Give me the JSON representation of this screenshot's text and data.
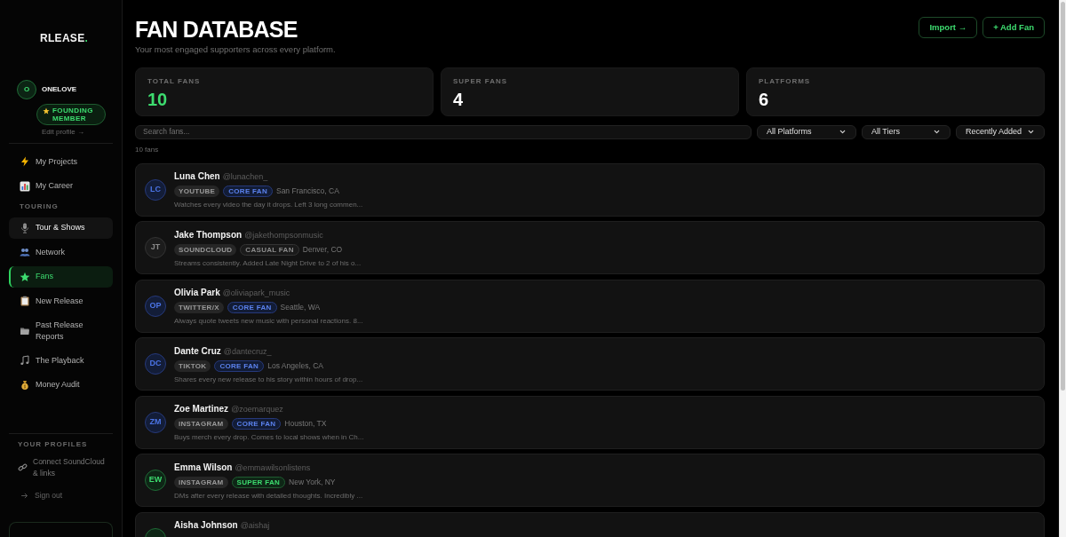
{
  "sidebar": {
    "logo": {
      "text": "RLEASE",
      "dot": "."
    },
    "profile": {
      "initial": "O",
      "name": "ONELOVE",
      "badge": "FOUNDING MEMBER",
      "edit_link": "Edit profile →"
    },
    "nav": [
      {
        "label": "My Projects",
        "selected": false,
        "hovered": false
      },
      {
        "label": "My Career",
        "selected": false,
        "hovered": false
      }
    ],
    "touring": {
      "heading": "TOURING",
      "items": [
        {
          "label": "Tour & Shows",
          "selected": false,
          "hovered": true
        },
        {
          "label": "Network",
          "selected": false,
          "hovered": false
        },
        {
          "label": "Fans",
          "selected": true,
          "hovered": false
        },
        {
          "label": "New Release",
          "selected": false,
          "hovered": false
        },
        {
          "label": "Past Release Reports",
          "selected": false,
          "hovered": false
        },
        {
          "label": "The Playback",
          "selected": false,
          "hovered": false
        },
        {
          "label": "Money Audit",
          "selected": false,
          "hovered": false
        }
      ]
    },
    "profiles": {
      "heading": "YOUR PROFILES",
      "connect_link": "Connect SoundCloud & links",
      "sign_out": "Sign out"
    }
  },
  "header": {
    "title": "FAN DATABASE",
    "subtitle": "Your most engaged supporters across every platform.",
    "buttons": [
      {
        "label": "Import →"
      },
      {
        "label": "+ Add Fan"
      }
    ]
  },
  "stats": [
    {
      "label": "TOTAL FANS",
      "value": "10",
      "accent": true
    },
    {
      "label": "SUPER FANS",
      "value": "4",
      "accent": false
    },
    {
      "label": "PLATFORMS",
      "value": "6",
      "accent": false
    }
  ],
  "filters": {
    "search": {
      "placeholder": "Search fans..."
    },
    "selects": [
      {
        "value": "All Platforms"
      },
      {
        "value": "All Tiers"
      },
      {
        "value": "Recently Added"
      }
    ]
  },
  "count": "10 fans",
  "fans": [
    {
      "kind": "core",
      "initials": "LC",
      "name": "Luna Chen",
      "handle": "@lunachen_",
      "platform": "YOUTUBE",
      "tier": "CORE FAN",
      "location": "San Francisco, CA",
      "note": "Watches every video the day it drops. Left 3 long commen..."
    },
    {
      "kind": "casual",
      "initials": "JT",
      "name": "Jake Thompson",
      "handle": "@jakethompsonmusic",
      "platform": "SOUNDCLOUD",
      "tier": "CASUAL FAN",
      "location": "Denver, CO",
      "note": "Streams consistently. Added Late Night Drive to 2 of his o..."
    },
    {
      "kind": "core",
      "initials": "OP",
      "name": "Olivia Park",
      "handle": "@oliviapark_music",
      "platform": "TWITTER/X",
      "tier": "CORE FAN",
      "location": "Seattle, WA",
      "note": "Always quote tweets new music with personal reactions. 8..."
    },
    {
      "kind": "core",
      "initials": "DC",
      "name": "Dante Cruz",
      "handle": "@dantecruz_",
      "platform": "TIKTOK",
      "tier": "CORE FAN",
      "location": "Los Angeles, CA",
      "note": "Shares every new release to his story within hours of drop..."
    },
    {
      "kind": "core",
      "initials": "ZM",
      "name": "Zoe Martinez",
      "handle": "@zoemarquez",
      "platform": "INSTAGRAM",
      "tier": "CORE FAN",
      "location": "Houston, TX",
      "note": "Buys merch every drop. Comes to local shows when in Ch..."
    },
    {
      "kind": "super",
      "initials": "EW",
      "name": "Emma Wilson",
      "handle": "@emmawilsonlistens",
      "platform": "INSTAGRAM",
      "tier": "SUPER FAN",
      "location": "New York, NY",
      "note": "DMs after every release with detailed thoughts. Incredibly ..."
    },
    {
      "kind": "super",
      "name": "Aisha Johnson",
      "handle": "@aishaj"
    }
  ]
}
